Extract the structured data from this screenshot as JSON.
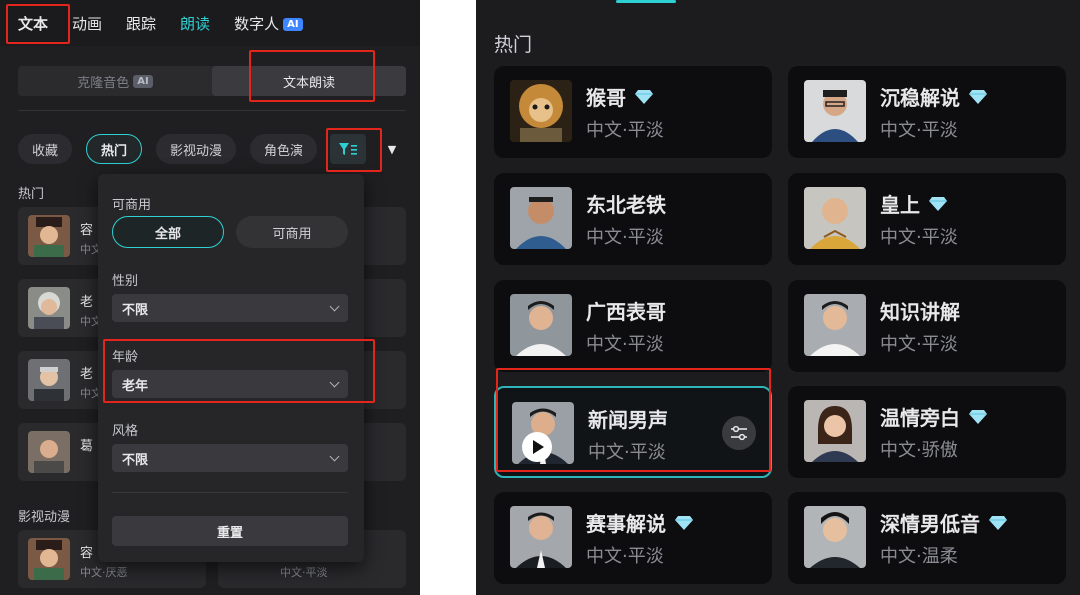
{
  "left_panel": {
    "top_tabs": [
      {
        "label": "文本"
      },
      {
        "label": "动画"
      },
      {
        "label": "跟踪"
      },
      {
        "label": "朗读"
      },
      {
        "label": "数字人",
        "badge": "AI"
      }
    ],
    "segments": [
      {
        "label": "克隆音色",
        "badge": "AI"
      },
      {
        "label": "文本朗读"
      }
    ],
    "chips": [
      "收藏",
      "热门",
      "影视动漫",
      "角色演"
    ],
    "section_hot": "热门",
    "section_film": "影视动漫",
    "cards": [
      {
        "name": "容",
        "sub": "中文"
      },
      {
        "name": "老",
        "sub": "中文"
      },
      {
        "name": "老",
        "sub": "中文"
      },
      {
        "name": "葛",
        "sub": ""
      },
      {
        "name": "容",
        "sub": "中文·厌恶"
      },
      {
        "name": "",
        "sub": "中文·平淡"
      }
    ],
    "filter_popup": {
      "commercial_label": "可商用",
      "commercial_options": [
        "全部",
        "可商用"
      ],
      "gender_label": "性别",
      "gender_value": "不限",
      "age_label": "年龄",
      "age_value": "老年",
      "style_label": "风格",
      "style_value": "不限",
      "reset_label": "重置"
    }
  },
  "right_panel": {
    "title": "热门",
    "voices": [
      {
        "name": "猴哥",
        "sub": "中文·平淡",
        "premium": true
      },
      {
        "name": "沉稳解说",
        "sub": "中文·平淡",
        "premium": true
      },
      {
        "name": "东北老铁",
        "sub": "中文·平淡",
        "premium": false
      },
      {
        "name": "皇上",
        "sub": "中文·平淡",
        "premium": true
      },
      {
        "name": "广西表哥",
        "sub": "中文·平淡",
        "premium": false
      },
      {
        "name": "知识讲解",
        "sub": "中文·平淡",
        "premium": false
      },
      {
        "name": "新闻男声",
        "sub": "中文·平淡",
        "premium": false
      },
      {
        "name": "温情旁白",
        "sub": "中文·骄傲",
        "premium": true
      },
      {
        "name": "赛事解说",
        "sub": "中文·平淡",
        "premium": true
      },
      {
        "name": "深情男低音",
        "sub": "中文·温柔",
        "premium": true
      }
    ]
  },
  "colors": {
    "accent": "#2fd0d2",
    "highlight_box": "#e2261c",
    "ai_badge": "#3d86ff",
    "premium_diamond": "#9fe3f5"
  }
}
